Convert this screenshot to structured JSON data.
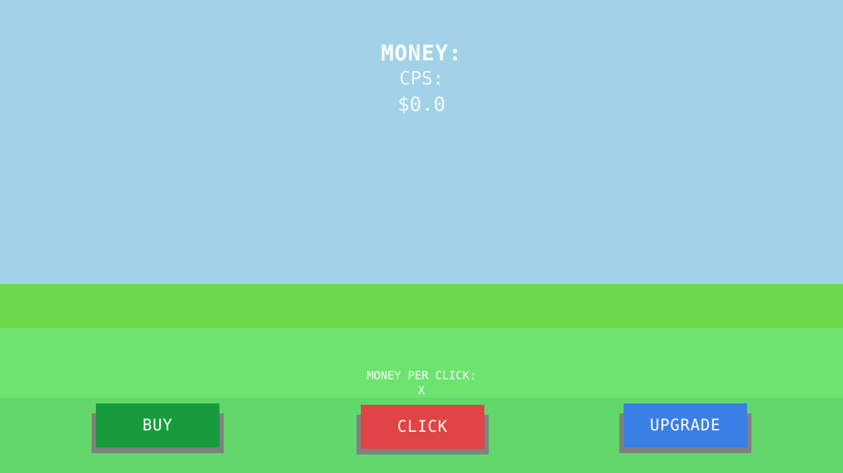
{
  "stats": {
    "money_label": "MONEY:",
    "cps_label": "CPS:",
    "money_amount": "$0.0"
  },
  "money_per_click": {
    "label": "MONEY PER CLICK:",
    "value": "X"
  },
  "buttons": {
    "buy": {
      "label": "BUY",
      "color": "#169c3c"
    },
    "click": {
      "label": "CLICK",
      "color": "#e04444"
    },
    "upgrade": {
      "label": "UPGRADE",
      "color": "#3a7fe6"
    }
  },
  "colors": {
    "sky": "#a1d2e8",
    "grass_top": "#6cd84a",
    "grass_mid": "#6ce46e",
    "grass_bottom": "#62d86c",
    "button_shadow": "#808080"
  }
}
